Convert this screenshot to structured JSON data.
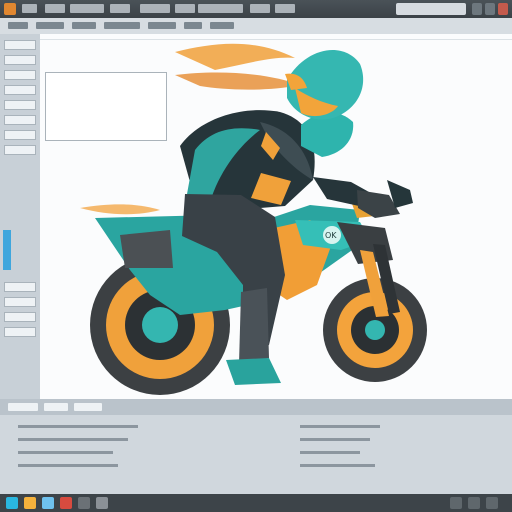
{
  "titlebar": {
    "title": "",
    "menu_items": [
      "",
      "",
      "",
      "",
      "",
      "",
      "",
      ""
    ]
  },
  "menubar": {
    "items": [
      "",
      "",
      "",
      "",
      "",
      "",
      ""
    ]
  },
  "sidebar": {
    "items": [
      "",
      "",
      "",
      "",
      "",
      "",
      "",
      "",
      "",
      "",
      "",
      ""
    ]
  },
  "editor": {
    "code_lines": [
      "",
      "",
      "",
      "",
      "",
      "",
      ""
    ],
    "card_text": ""
  },
  "bottom_panel": {
    "tabs": [
      "",
      "",
      ""
    ],
    "rows": [
      "",
      "",
      "",
      "",
      "",
      "",
      "",
      ""
    ]
  },
  "taskbar": {
    "items": [
      "",
      "",
      "",
      "",
      "",
      ""
    ]
  },
  "artwork": {
    "subject": "",
    "colors": {
      "helmet": "#33b7b0",
      "jacket": "#25363a",
      "orange": "#e9962f",
      "bike": "#2a9f9b",
      "tire": "#3c4043",
      "glow": "#f29a2f"
    }
  }
}
